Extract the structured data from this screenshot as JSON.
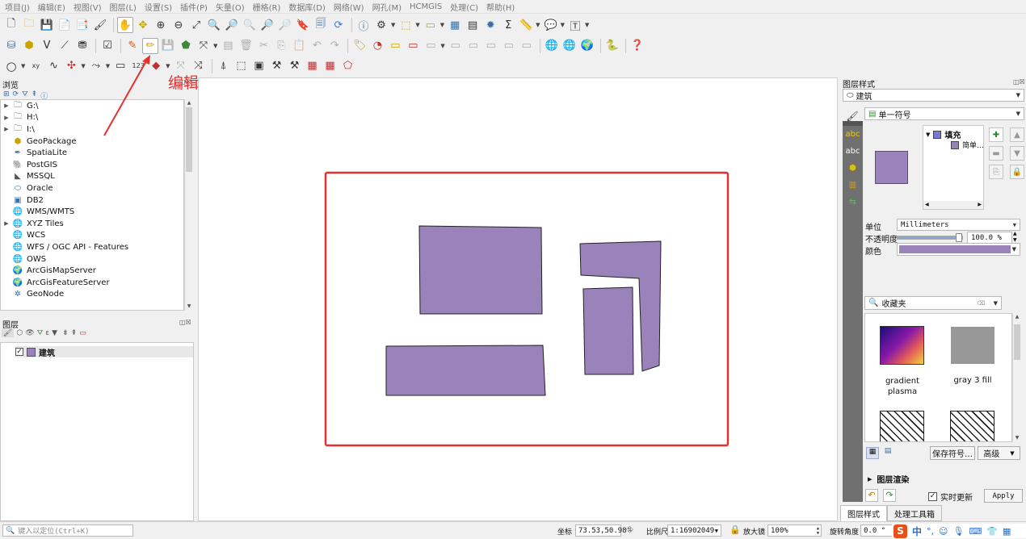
{
  "menu": [
    "项目(J)",
    "编辑(E)",
    "视图(V)",
    "图层(L)",
    "设置(S)",
    "插件(P)",
    "矢量(O)",
    "栅格(R)",
    "数据库(D)",
    "网络(W)",
    "网孔(M)",
    "HCMGIS",
    "处理(C)",
    "帮助(H)"
  ],
  "annotation": {
    "text": "编辑",
    "color": "#e53030"
  },
  "browser": {
    "title": "浏览",
    "items": [
      {
        "label": "G:\\",
        "icon": "folder-icon",
        "expandable": true
      },
      {
        "label": "H:\\",
        "icon": "folder-icon",
        "expandable": true
      },
      {
        "label": "I:\\",
        "icon": "folder-icon",
        "expandable": true
      },
      {
        "label": "GeoPackage",
        "icon": "geopackage-icon",
        "expandable": false
      },
      {
        "label": "SpatiaLite",
        "icon": "spatialite-icon",
        "expandable": false
      },
      {
        "label": "PostGIS",
        "icon": "postgis-icon",
        "expandable": false
      },
      {
        "label": "MSSQL",
        "icon": "mssql-icon",
        "expandable": false
      },
      {
        "label": "Oracle",
        "icon": "oracle-icon",
        "expandable": false
      },
      {
        "label": "DB2",
        "icon": "db2-icon",
        "expandable": false
      },
      {
        "label": "WMS/WMTS",
        "icon": "globe-icon",
        "expandable": false
      },
      {
        "label": "XYZ Tiles",
        "icon": "globe-icon",
        "expandable": true
      },
      {
        "label": "WCS",
        "icon": "globe-icon",
        "expandable": false
      },
      {
        "label": "WFS / OGC API - Features",
        "icon": "globe-icon",
        "expandable": false
      },
      {
        "label": "OWS",
        "icon": "globe-icon",
        "expandable": false
      },
      {
        "label": "ArcGisMapServer",
        "icon": "arcgis-icon",
        "expandable": false
      },
      {
        "label": "ArcGisFeatureServer",
        "icon": "arcgis-icon",
        "expandable": false
      },
      {
        "label": "GeoNode",
        "icon": "geonode-icon",
        "expandable": false
      }
    ]
  },
  "layers": {
    "title": "图层",
    "items": [
      {
        "name": "建筑",
        "checked": true,
        "fill": "#9a82bb"
      }
    ]
  },
  "style": {
    "title": "图层样式",
    "layer_select": "建筑",
    "renderer": "单一符号",
    "symbol_tree": {
      "root": "填充",
      "child": "简单…"
    },
    "unit_label": "单位",
    "unit_value": "Millimeters",
    "opacity_label": "不透明度",
    "opacity_value": "100.0 %",
    "opacity_fraction": 1.0,
    "color_label": "颜色",
    "color_value": "#9a82bb",
    "search_placeholder": "收藏夹",
    "symbols": [
      {
        "label": "gradient plasma"
      },
      {
        "label": "gray 3 fill"
      },
      {
        "label": ""
      },
      {
        "label": ""
      }
    ],
    "save_symbol": "保存符号…",
    "advanced": "高级",
    "layer_render": "图层渲染",
    "live_update": "实时更新",
    "apply": "Apply",
    "tabs": [
      "图层样式",
      "处理工具箱"
    ]
  },
  "status": {
    "locate_placeholder": "键入以定位(Ctrl+K)",
    "coord_label": "坐标",
    "coord_value": "73.53,50.98",
    "scale_label": "比例尺",
    "scale_value": "1:16902049",
    "magnifier_label": "放大镜",
    "magnifier_value": "100%",
    "rotation_label": "旋转角度",
    "rotation_value": "0.0 °",
    "ime": "中"
  },
  "map": {
    "feature_fill": "#9a82bb",
    "frame_color": "#e53030"
  }
}
